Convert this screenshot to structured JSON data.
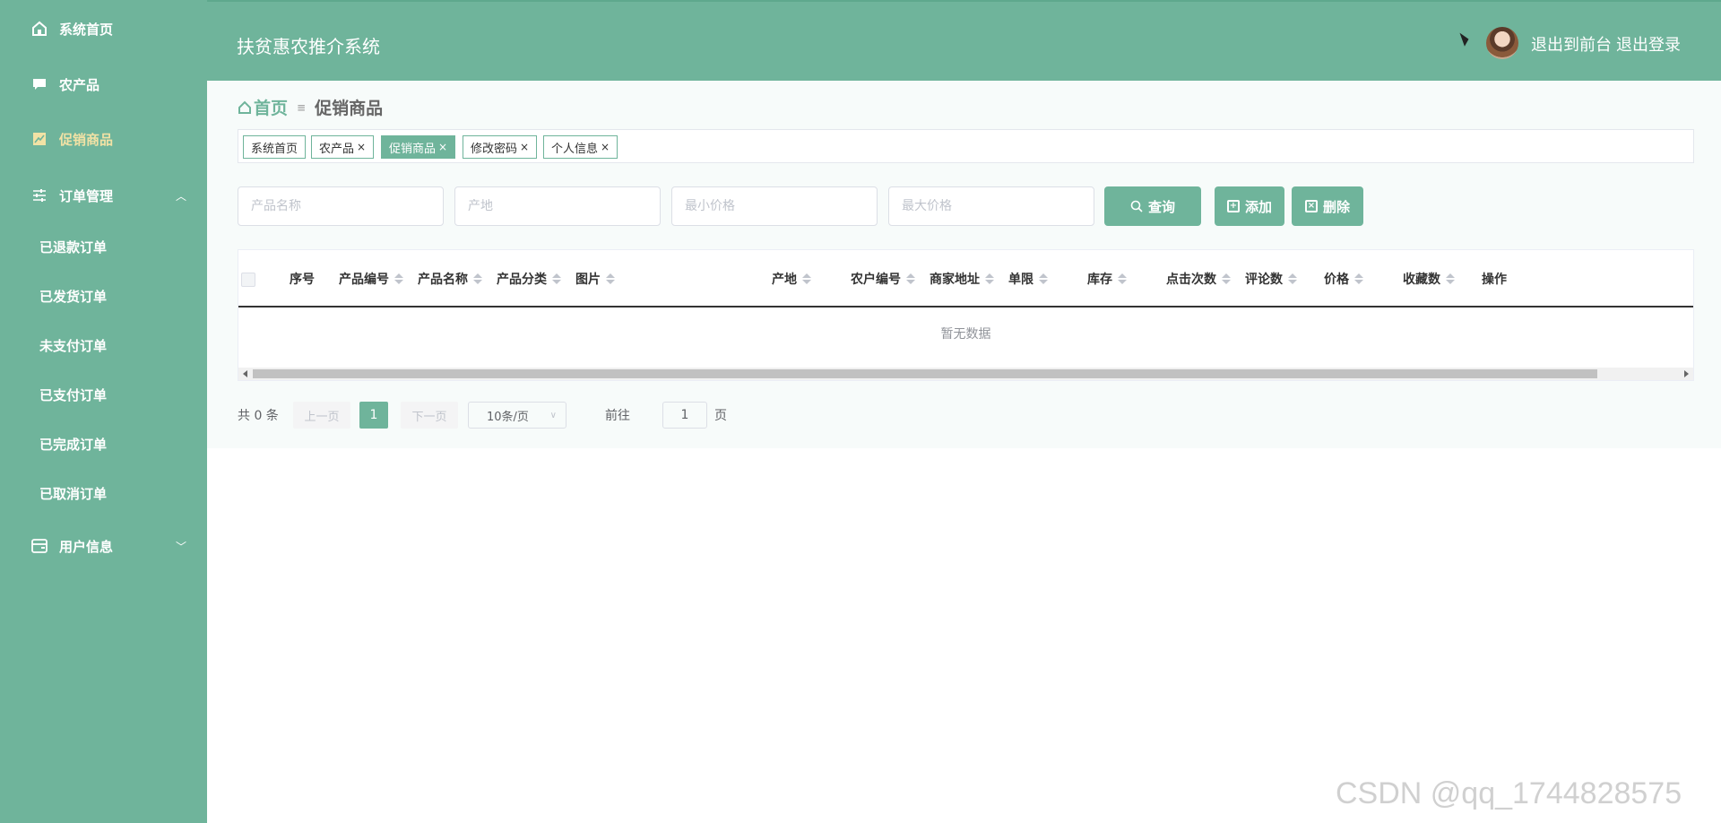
{
  "app": {
    "title": "扶贫惠农推介系统"
  },
  "sidebar": {
    "items": [
      {
        "label": "系统首页",
        "icon": "home-icon"
      },
      {
        "label": "农产品",
        "icon": "chat-icon"
      },
      {
        "label": "促销商品",
        "icon": "chart-icon",
        "active": true
      },
      {
        "label": "订单管理",
        "icon": "sliders-icon",
        "expanded": true
      }
    ],
    "order_sub": [
      "已退款订单",
      "已发货订单",
      "未支付订单",
      "已支付订单",
      "已完成订单",
      "已取消订单"
    ],
    "user_info": {
      "label": "用户信息",
      "icon": "wallet-icon"
    }
  },
  "header": {
    "to_front": "退出到前台",
    "logout": "退出登录"
  },
  "breadcrumb": {
    "home": "首页",
    "separator": "≡",
    "current": "促销商品"
  },
  "tags": [
    {
      "label": "系统首页"
    },
    {
      "label": "农产品",
      "close": "×"
    },
    {
      "label": "促销商品",
      "close": "×",
      "active": true
    },
    {
      "label": "修改密码",
      "close": "×"
    },
    {
      "label": "个人信息",
      "close": "×"
    }
  ],
  "search": {
    "product_name": "产品名称",
    "origin": "产地",
    "min_price": "最小价格",
    "max_price": "最大价格",
    "query": "查询",
    "add": "添加",
    "delete": "删除"
  },
  "table": {
    "columns": [
      {
        "label": "序号",
        "sortable": false
      },
      {
        "label": "产品编号",
        "sortable": true
      },
      {
        "label": "产品名称",
        "sortable": true
      },
      {
        "label": "产品分类",
        "sortable": true
      },
      {
        "label": "图片",
        "sortable": true
      },
      {
        "label": "产地",
        "sortable": true
      },
      {
        "label": "农户编号",
        "sortable": true
      },
      {
        "label": "商家地址",
        "sortable": true
      },
      {
        "label": "单限",
        "sortable": true
      },
      {
        "label": "库存",
        "sortable": true
      },
      {
        "label": "点击次数",
        "sortable": true
      },
      {
        "label": "评论数",
        "sortable": true
      },
      {
        "label": "价格",
        "sortable": true
      },
      {
        "label": "收藏数",
        "sortable": true
      },
      {
        "label": "操作",
        "sortable": false
      }
    ],
    "empty_text": "暂无数据"
  },
  "pagination": {
    "total": "共 0 条",
    "prev": "上一页",
    "current_page": "1",
    "next": "下一页",
    "page_size": "10条/页",
    "goto": "前往",
    "jump_value": "1",
    "page_suffix": "页"
  },
  "watermark": "CSDN @qq_1744828575",
  "colors": {
    "primary": "#6fb49b",
    "active_text": "#f2e2a5"
  }
}
